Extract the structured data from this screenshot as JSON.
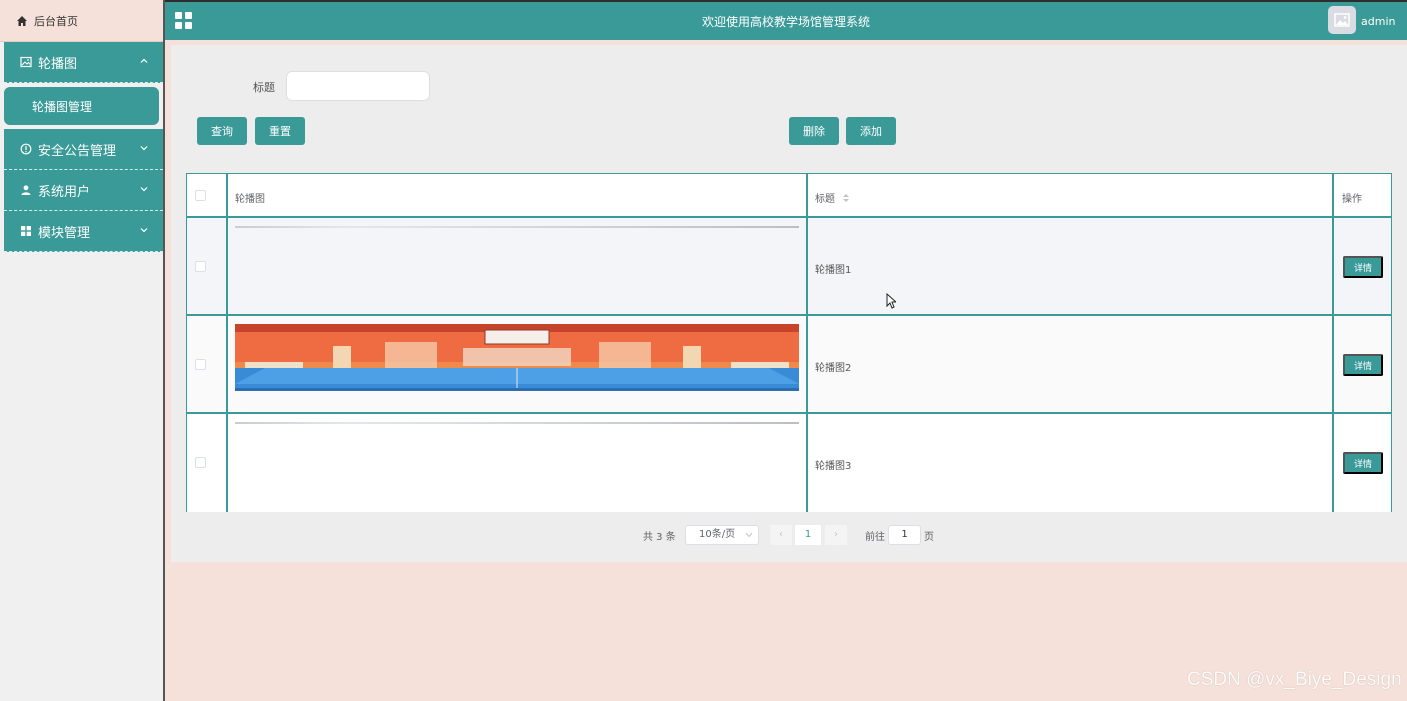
{
  "sidebar": {
    "home_label": "后台首页",
    "groups": [
      {
        "label": "轮播图",
        "icon": "image-icon",
        "expanded": true,
        "children": [
          "轮播图管理"
        ]
      },
      {
        "label": "安全公告管理",
        "icon": "info-circle-icon",
        "expanded": false
      },
      {
        "label": "系统用户",
        "icon": "user-icon",
        "expanded": false
      },
      {
        "label": "模块管理",
        "icon": "grid-icon",
        "expanded": false
      }
    ]
  },
  "header": {
    "title": "欢迎使用高校教学场馆管理系统",
    "username": "admin"
  },
  "search": {
    "title_label": "标题",
    "title_value": "",
    "query_label": "查询",
    "reset_label": "重置",
    "delete_label": "删除",
    "add_label": "添加"
  },
  "table": {
    "headers": [
      "轮播图",
      "标题",
      "操作"
    ],
    "rows": [
      {
        "image": "thin-banner-placeholder",
        "title": "轮播图1",
        "action": "详情"
      },
      {
        "image": "sports-hall-banner",
        "title": "轮播图2",
        "action": "详情"
      },
      {
        "image": "thin-banner-placeholder",
        "title": "轮播图3",
        "action": "详情"
      }
    ]
  },
  "pagination": {
    "total_text": "共 3 条",
    "page_size": "10条/页",
    "current_page": "1",
    "goto_label": "前往",
    "goto_value": "1",
    "page_suffix": "页"
  },
  "watermark": "CSDN @vx_Biye_Design",
  "colors": {
    "primary": "#3a9a98",
    "background": "#f5e1d9",
    "panel": "#ededed"
  }
}
